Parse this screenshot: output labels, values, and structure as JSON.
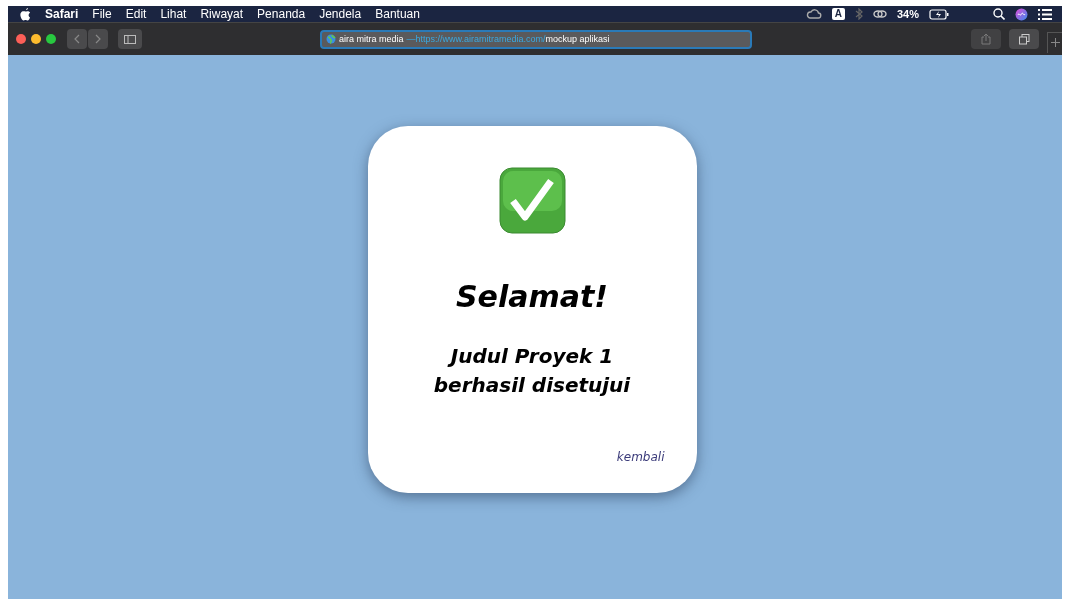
{
  "menu_bar": {
    "app": "Safari",
    "items": [
      "File",
      "Edit",
      "Lihat",
      "Riwayat",
      "Penanda",
      "Jendela",
      "Bantuan"
    ],
    "input_source": "A",
    "battery": "34%"
  },
  "toolbar": {
    "address": {
      "site": "aira mitra media",
      "separator": "—",
      "url": "https://www.airamitramedia.com/",
      "page": "mockup aplikasi"
    }
  },
  "card": {
    "title": "Selamat!",
    "message": "Judul Proyek 1 berhasil disetujui",
    "link": "kembali"
  }
}
